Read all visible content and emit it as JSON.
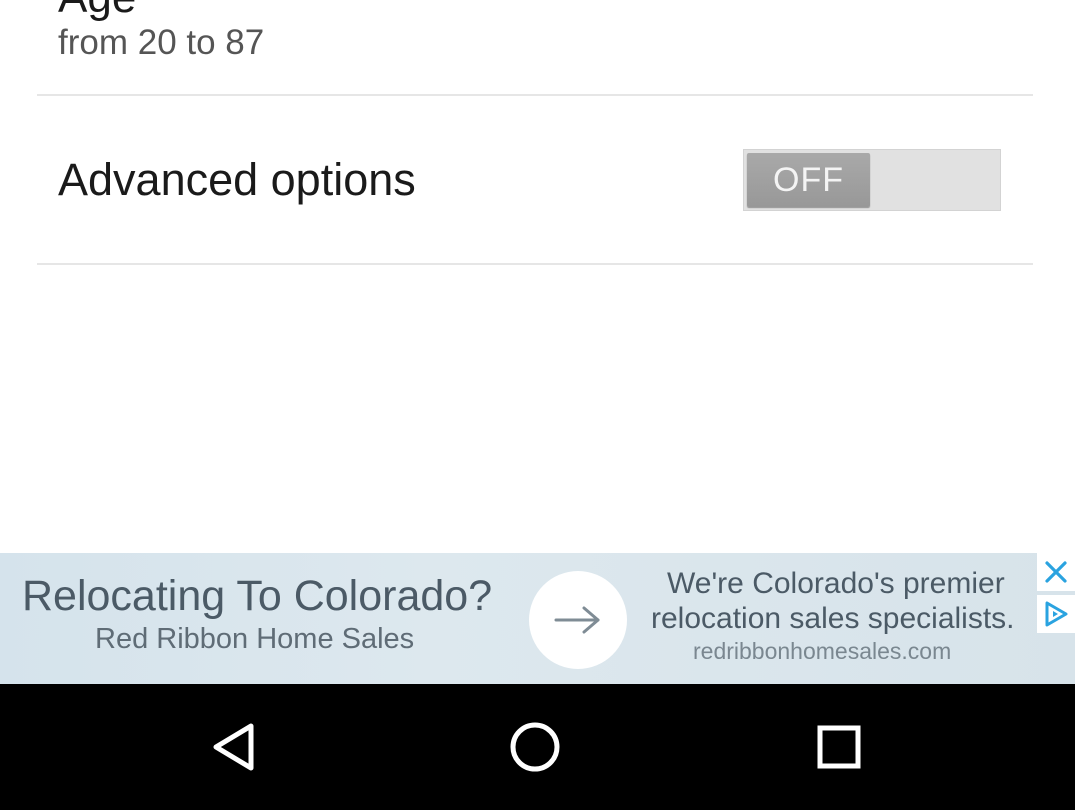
{
  "preferences": {
    "age": {
      "title": "Age",
      "summary": "from 20 to 87"
    },
    "advanced": {
      "title": "Advanced options",
      "toggle_label": "OFF",
      "enabled": false
    }
  },
  "ad": {
    "headline": "Relocating To Colorado?",
    "advertiser": "Red Ribbon Home Sales",
    "body_line1": "We're Colorado's premier",
    "body_line2": "relocation sales specialists.",
    "url": "redribbonhomesales.com",
    "cta_icon": "arrow-right-icon",
    "close_icon": "close-icon",
    "choices_icon": "adchoices-icon",
    "accent_color": "#2aa3e0"
  },
  "navigation": {
    "back_icon": "back-triangle-icon",
    "home_icon": "home-circle-icon",
    "recents_icon": "recents-square-icon"
  }
}
